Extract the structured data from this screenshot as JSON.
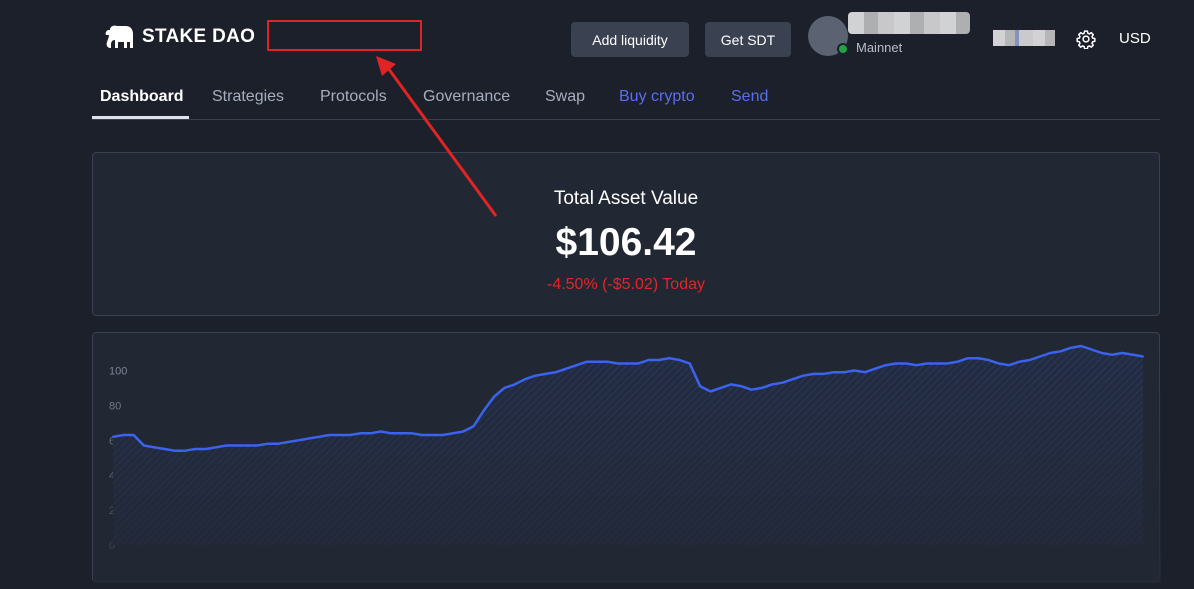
{
  "header": {
    "logo_text": "STAKE DAO",
    "logo_icon": "elephant-icon",
    "add_liquidity_label": "Add liquidity",
    "get_sdt_label": "Get SDT",
    "network_label": "Mainnet",
    "currency_label": "USD",
    "settings_icon": "gear-icon"
  },
  "tabs": [
    {
      "label": "Dashboard",
      "active": true
    },
    {
      "label": "Strategies"
    },
    {
      "label": "Protocols"
    },
    {
      "label": "Governance"
    },
    {
      "label": "Swap"
    },
    {
      "label": "Buy crypto",
      "link": true
    },
    {
      "label": "Send",
      "link": true
    }
  ],
  "summary": {
    "title": "Total Asset Value",
    "amount": "$106.42",
    "change": "-4.50% (-$5.02) Today"
  },
  "colors": {
    "background": "#1c202b",
    "card": "#222734",
    "accent_link": "#5b6ef0",
    "line": "#3b63ef",
    "negative": "#e12626",
    "online": "#1fa345",
    "annotation": "#e02424"
  },
  "chart_data": {
    "type": "area",
    "x": [
      0,
      1,
      2,
      3,
      4,
      5,
      6,
      7,
      8,
      9,
      10,
      11,
      12,
      13,
      14,
      15,
      16,
      17,
      18,
      19,
      20,
      21,
      22,
      23,
      24,
      25,
      26,
      27,
      28,
      29,
      30,
      31,
      32,
      33,
      34,
      35,
      36,
      37,
      38,
      39,
      40,
      41,
      42,
      43,
      44,
      45,
      46,
      47,
      48,
      49,
      50,
      51,
      52,
      53,
      54,
      55,
      56,
      57,
      58,
      59,
      60,
      61,
      62,
      63,
      64,
      65,
      66,
      67,
      68,
      69,
      70,
      71,
      72,
      73,
      74,
      75,
      76,
      77,
      78,
      79,
      80,
      81,
      82,
      83,
      84,
      85,
      86,
      87,
      88,
      89,
      90,
      91,
      92,
      93,
      94,
      95,
      96,
      97,
      98,
      99,
      100
    ],
    "values": [
      62,
      63,
      63,
      57,
      56,
      55,
      54,
      54,
      55,
      55,
      56,
      57,
      57,
      57,
      57,
      58,
      58,
      59,
      60,
      61,
      62,
      63,
      63,
      63,
      64,
      64,
      65,
      64,
      64,
      64,
      63,
      63,
      63,
      64,
      65,
      68,
      77,
      85,
      90,
      92,
      95,
      97,
      98,
      99,
      101,
      103,
      105,
      105,
      105,
      104,
      104,
      104,
      106,
      106,
      107,
      106,
      104,
      91,
      88,
      90,
      92,
      91,
      89,
      90,
      92,
      93,
      95,
      97,
      98,
      98,
      99,
      99,
      100,
      99,
      101,
      103,
      104,
      104,
      103,
      104,
      104,
      104,
      105,
      107,
      107,
      106,
      104,
      103,
      105,
      106,
      108,
      110,
      111,
      113,
      114,
      112,
      110,
      109,
      110,
      109,
      108
    ],
    "ylim": [
      0,
      110
    ],
    "y_ticks": [
      0,
      20,
      40,
      60,
      80,
      100
    ],
    "grid": false,
    "title": "",
    "xlabel": "",
    "ylabel": ""
  },
  "annotation": {
    "type": "red-box-with-arrow",
    "target": "redacted-area-next-to-logo"
  }
}
